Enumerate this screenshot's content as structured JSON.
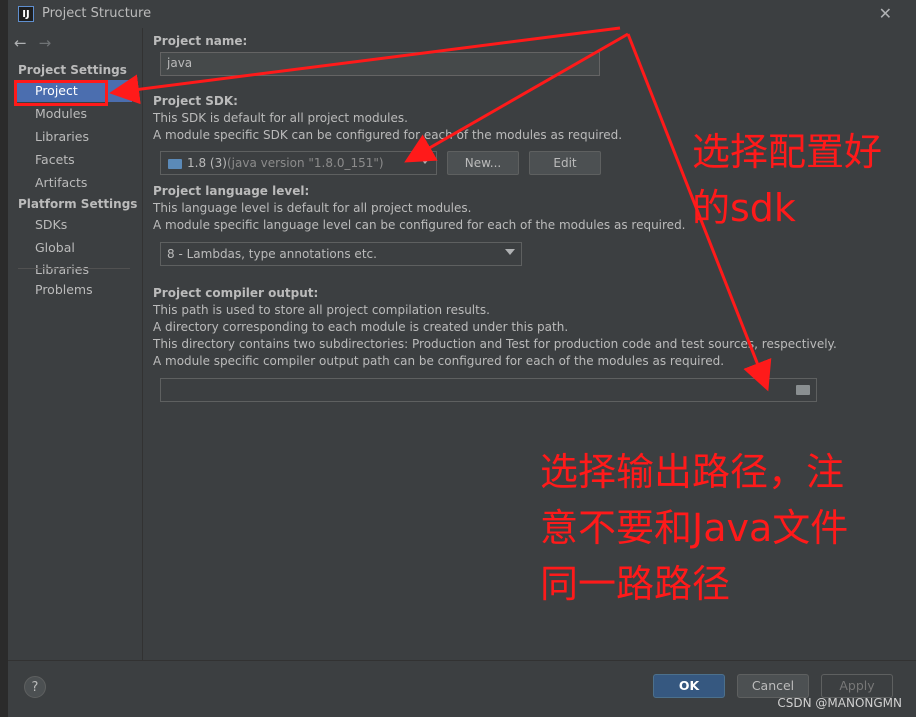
{
  "window": {
    "title": "Project Structure",
    "app_icon": "IJ"
  },
  "sidebar": {
    "nav_back": "←",
    "nav_forward": "→",
    "sections": [
      {
        "heading": "Project Settings",
        "items": [
          "Project",
          "Modules",
          "Libraries",
          "Facets",
          "Artifacts"
        ]
      },
      {
        "heading": "Platform Settings",
        "items": [
          "SDKs",
          "Global Libraries"
        ]
      }
    ],
    "problems": "Problems",
    "selected": "Project"
  },
  "content": {
    "project_name": {
      "label": "Project name:",
      "value": "java"
    },
    "sdk": {
      "label": "Project SDK:",
      "desc1": "This SDK is default for all project modules.",
      "desc2": "A module specific SDK can be configured for each of the modules as required.",
      "value": "1.8 (3)",
      "value_detail": "(java version \"1.8.0_151\")",
      "new_button": "New...",
      "edit_button": "Edit"
    },
    "language_level": {
      "label": "Project language level:",
      "desc1": "This language level is default for all project modules.",
      "desc2": "A module specific language level can be configured for each of the modules as required.",
      "value": "8 - Lambdas, type annotations etc."
    },
    "compiler_output": {
      "label": "Project compiler output:",
      "desc1": "This path is used to store all project compilation results.",
      "desc2": "A directory corresponding to each module is created under this path.",
      "desc3": "This directory contains two subdirectories: Production and Test for production code and test sources, respectively.",
      "desc4": "A module specific compiler output path can be configured for each of the modules as required.",
      "value": ""
    }
  },
  "footer": {
    "help": "?",
    "ok": "OK",
    "cancel": "Cancel",
    "apply": "Apply"
  },
  "annotations": {
    "note_sdk_line1": "选择配置好",
    "note_sdk_line2": "的sdk",
    "note_output_line1": "选择输出路径，注",
    "note_output_line2": "意不要和Java文件",
    "note_output_line3": "同一路路径",
    "color": "#ff1a1a"
  },
  "watermark": "CSDN @MANONGMN",
  "colors": {
    "background": "#3c3f41",
    "selection": "#4b6eaf",
    "ok_button": "#365880"
  }
}
